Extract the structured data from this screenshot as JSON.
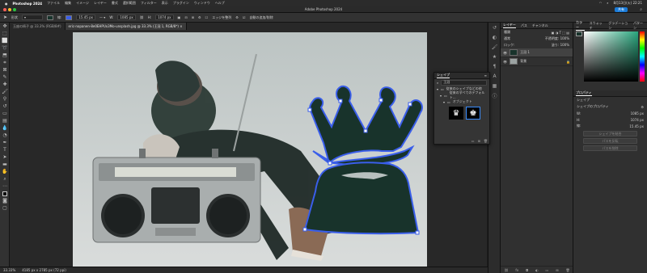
{
  "menubar": {
    "app": "Photoshop 2024",
    "items": [
      "ファイル",
      "編集",
      "イメージ",
      "レイヤー",
      "書式",
      "選択範囲",
      "フィルター",
      "表示",
      "プラグイン",
      "ウィンドウ",
      "ヘルプ"
    ],
    "clock": "8月13日(火) 22:21"
  },
  "window": {
    "title": "Adobe Photoshop 2024",
    "share": "共有"
  },
  "options": {
    "mode": "形状",
    "stroke_label": "線:",
    "stroke_width": "15.45 px",
    "w": "1085 px",
    "h": "1074 px",
    "align_edges": "エッジを整列",
    "auto_add": "自動の追加/削除"
  },
  "doc_tabs": [
    "玉座の椅子 @ 33.3% (RGB/8#)",
    "eric-nopanen-8e0EHPUx3Mo-unsplash.jpg @ 33.3% (王冠 1, RGB/8*) ×"
  ],
  "status": {
    "zoom": "33.33%",
    "size": "4185 px x 2785 px (72 ppi)"
  },
  "layers_panel": {
    "tabs": [
      "レイヤー",
      "パス",
      "チャンネル"
    ],
    "filter": "種類",
    "blend": "通常",
    "opacity_label": "不透明度:",
    "opacity": "100%",
    "lock_label": "ロック:",
    "fill_label": "塗り:",
    "fill": "100%",
    "layers": [
      {
        "name": "王冠 1",
        "selected": true
      },
      {
        "name": "背景",
        "selected": false
      }
    ]
  },
  "color_panel": {
    "tabs": [
      "カラー",
      "スウォッチ",
      "グラデーション",
      "パターン"
    ]
  },
  "properties_panel": {
    "title": "プロパティ",
    "subtitle": "シェイプ",
    "kind": "シェイプのプロパティ",
    "rows": [
      {
        "label": "W:",
        "value": "1085 px"
      },
      {
        "label": "H:",
        "value": "1074 px"
      },
      {
        "label": "線:",
        "value": "15.45 px"
      }
    ],
    "buttons": [
      "シェイプを結合",
      "パスを反転",
      "パスを削除"
    ]
  },
  "shapes_panel": {
    "title": "シェイプ",
    "search": "王冠",
    "items": [
      "従来のシェイプなどの他",
      "従来のすべてのデフォルト..."
    ],
    "group": "オブジェクト"
  },
  "colors": {
    "crown_fill": "#18332b",
    "crown_stroke": "#3a5eea",
    "accent": "#1a7bd8"
  }
}
